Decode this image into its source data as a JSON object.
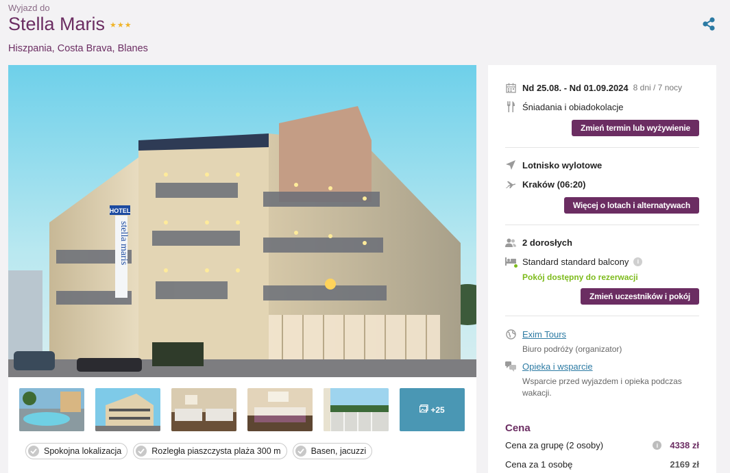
{
  "header": {
    "kicker": "Wyjazd do",
    "hotel_name": "Stella Maris",
    "stars": "★★★",
    "location": "Hiszpania, Costa Brava, Blanes"
  },
  "gallery": {
    "more_label": "+25",
    "tags": [
      "Spokojna lokalizacja",
      "Rozległa piaszczysta plaża 300 m",
      "Basen, jacuzzi"
    ]
  },
  "photo_signs": {
    "hotel_sign": "HOTEL",
    "hotel_vertical": "stella maris"
  },
  "booking": {
    "dates": "Nd 25.08. - Nd 01.09.2024",
    "duration": "8 dni / 7 nocy",
    "board": "Śniadania i obiadokolacje",
    "change_date_button": "Zmień termin lub wyżywienie",
    "airport_label": "Lotnisko wylotowe",
    "flight": "Kraków (06:20)",
    "flights_button": "Więcej o lotach i alternatywach",
    "travellers": "2 dorosłych",
    "room": "Standard standard balcony",
    "room_available": "Pokój dostępny do rezerwacji",
    "change_room_button": "Zmień uczestników i pokój",
    "organizer_name": "Exim Tours",
    "organizer_role": "Biuro podróży (organizator)",
    "support_link": "Opieka i wsparcie",
    "support_text": "Wsparcie przed wyjazdem i opieka podczas wakacji."
  },
  "price": {
    "title": "Cena",
    "group_label": "Cena za grupę (2 osoby)",
    "group_value": "4338 zł",
    "person_label": "Cena za 1 osobę",
    "person_value": "2169 zł"
  },
  "colors": {
    "brand": "#6b2d62",
    "link": "#2b7aa3",
    "available": "#7dbb1c",
    "stars": "#f0b428",
    "more_tile": "#4a97b4"
  }
}
